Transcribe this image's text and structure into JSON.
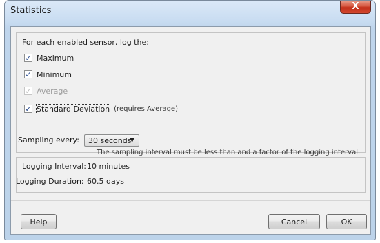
{
  "window": {
    "title": "Statistics",
    "close_glyph": "X"
  },
  "group": {
    "heading": "For each enabled sensor, log the:",
    "checkboxes": [
      {
        "label": "Maximum",
        "checked": true,
        "enabled": true
      },
      {
        "label": "Minimum",
        "checked": true,
        "enabled": true
      },
      {
        "label": "Average",
        "checked": true,
        "enabled": false
      },
      {
        "label": "Standard Deviation",
        "checked": true,
        "enabled": true,
        "note": "(requires Average)"
      }
    ],
    "sampling_label": "Sampling every:",
    "sampling_value": "30 seconds",
    "sampling_hint": "The sampling interval must be less than and a factor of the logging interval."
  },
  "info": {
    "interval_label": "Logging Interval:",
    "interval_value": "10 minutes",
    "duration_label": "Logging Duration:",
    "duration_value": "60.5 days"
  },
  "buttons": {
    "help": "Help",
    "cancel": "Cancel",
    "ok": "OK"
  },
  "glyphs": {
    "check": "✓",
    "dropdown": "▼"
  }
}
